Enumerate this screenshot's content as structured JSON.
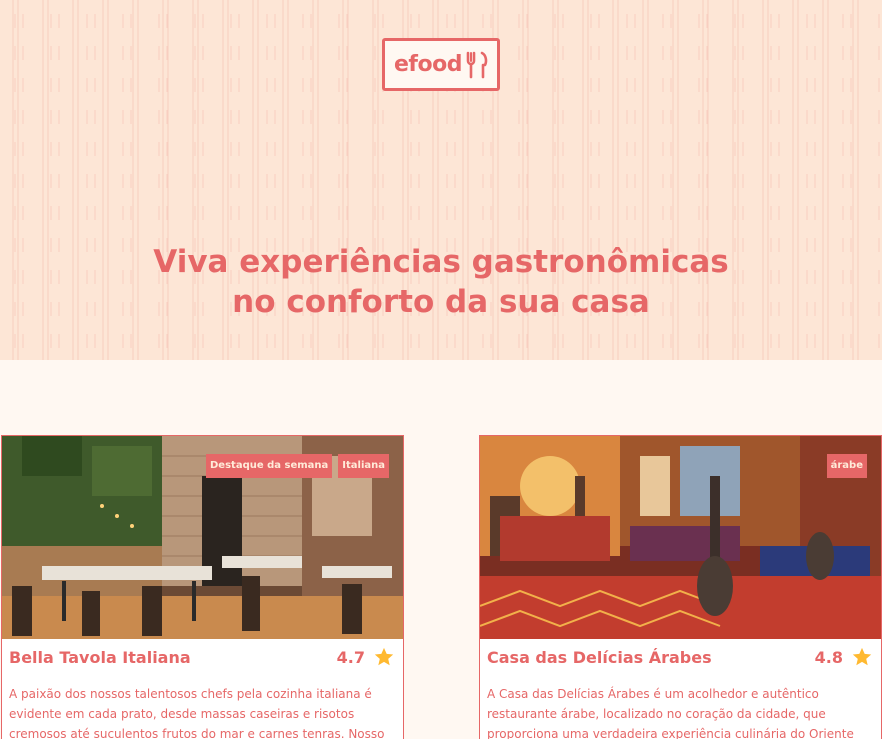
{
  "header": {
    "logo_text": "efood",
    "headline_line1": "Viva experiências gastronômicas",
    "headline_line2": "no conforto da sua casa"
  },
  "colors": {
    "accent": "#e66767",
    "hero_bg": "#fde6d6",
    "page_bg": "#fff8f2",
    "star": "#ffb930"
  },
  "restaurants": [
    {
      "name": "Bella Tavola Italiana",
      "rating": "4.7",
      "tags": [
        "Destaque da semana",
        "Italiana"
      ],
      "description": "A paixão dos nossos talentosos chefs pela cozinha italiana é evidente em cada prato, desde massas caseiras e risotos cremosos até suculentos frutos do mar e carnes tenras. Nosso",
      "image": "italian-restaurant-interior"
    },
    {
      "name": "Casa das Delícias Árabes",
      "rating": "4.8",
      "tags": [
        "árabe"
      ],
      "description": "A Casa das Delícias Árabes é um acolhedor e autêntico restaurante árabe, localizado no coração da cidade, que proporciona uma verdadeira experiência culinária do Oriente",
      "image": "arabic-restaurant-interior"
    }
  ],
  "icons": {
    "logo": "fork-knife-icon",
    "rating": "star-icon"
  }
}
